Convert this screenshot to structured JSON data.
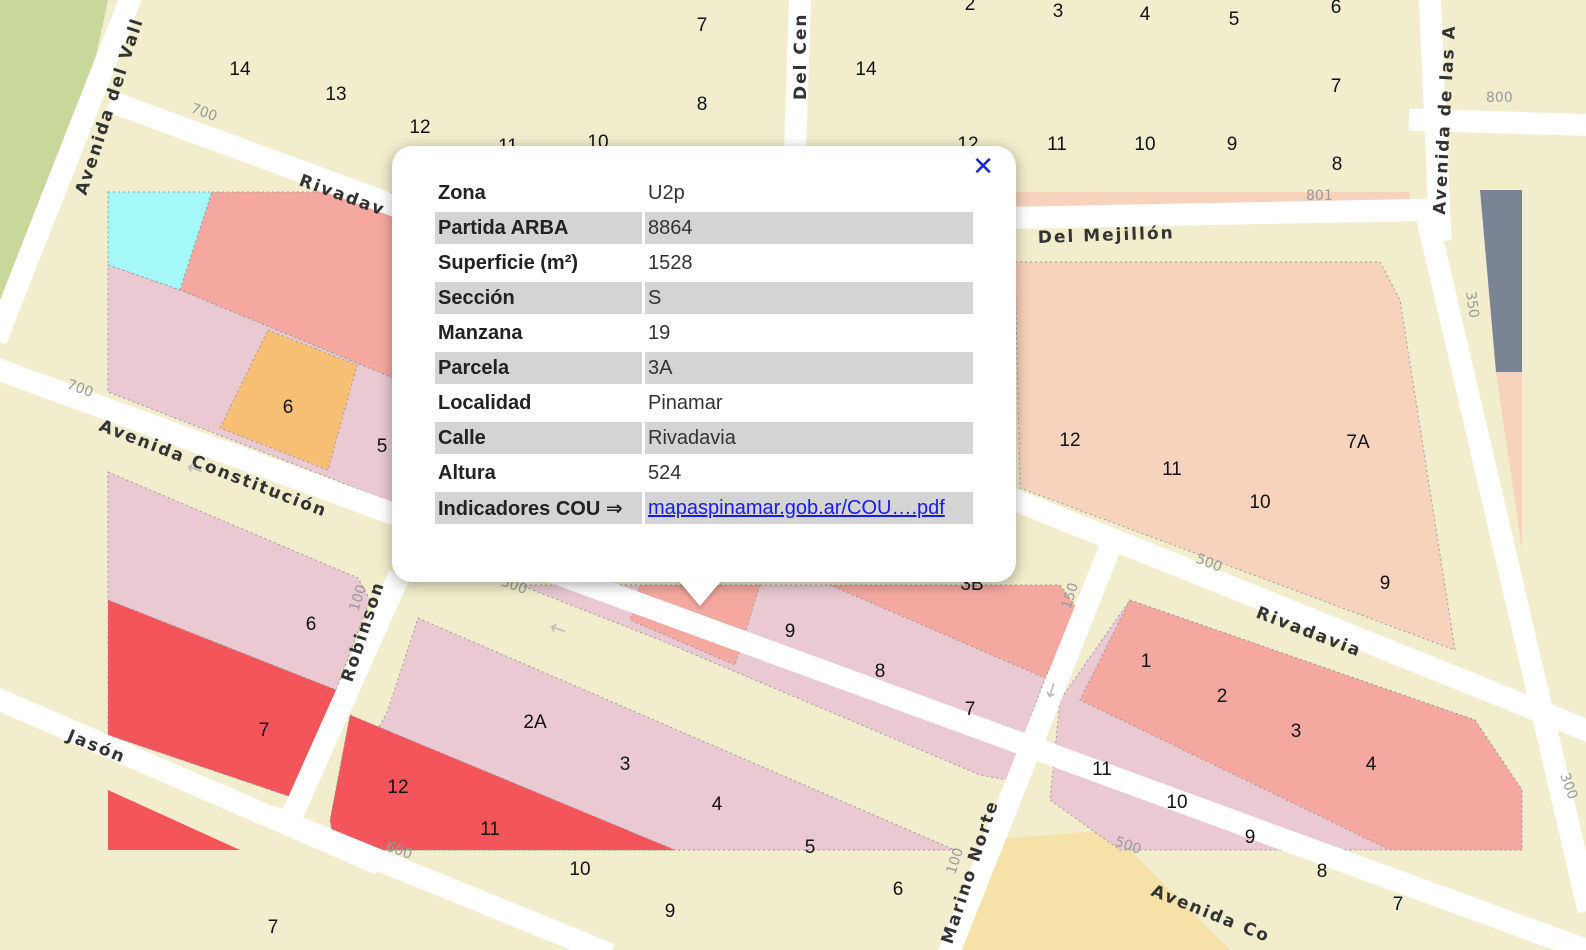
{
  "popup": {
    "close_label": "✕",
    "rows": [
      {
        "key": "Zona",
        "value": "U2p"
      },
      {
        "key": "Partida ARBA",
        "value": "8864"
      },
      {
        "key": "Superficie (m²)",
        "value": "1528"
      },
      {
        "key": "Sección",
        "value": "S"
      },
      {
        "key": "Manzana",
        "value": "19"
      },
      {
        "key": "Parcela",
        "value": "3A"
      },
      {
        "key": "Localidad",
        "value": "Pinamar"
      },
      {
        "key": "Calle",
        "value": "Rivadavia"
      },
      {
        "key": "Altura",
        "value": "524"
      },
      {
        "key": "Indicadores COU ⇒",
        "value": "mapaspinamar.gob.ar/COU….pdf"
      }
    ]
  },
  "streets": {
    "rivadavia_nw": "Rivadav",
    "rivadavia_se": "Rivadavia",
    "constitucion": "Avenida Constitución",
    "del_mejillon": "Del Mejillón",
    "robinson": "Robinson",
    "jason": "Jasón",
    "marino_norte": "Marino Norte",
    "avenida_del_valle": "Avenida del Vall",
    "del_centro": "Del Cen",
    "avenida_de_las": "Avenida de las A",
    "avenida_co": "Avenida Co"
  },
  "address_numbers": [
    "700",
    "700",
    "800",
    "801",
    "350",
    "500",
    "150",
    "100",
    "300",
    "500",
    "600",
    "100",
    "500"
  ],
  "parcel_labels": [
    "14",
    "13",
    "12",
    "11",
    "10",
    "7",
    "8",
    "2",
    "3",
    "4",
    "5",
    "6",
    "14",
    "7",
    "12",
    "11",
    "10",
    "9",
    "8",
    "6",
    "5",
    "12",
    "11",
    "10",
    "7A",
    "9",
    "3B",
    "9",
    "8",
    "7",
    "6",
    "7",
    "2A",
    "3",
    "4",
    "5",
    "12",
    "11",
    "10",
    "9",
    "1",
    "2",
    "3",
    "4",
    "11",
    "10",
    "9",
    "8",
    "7",
    "6",
    "7"
  ],
  "colors": {
    "background": "#f2edcd",
    "road": "#ffffff",
    "parcel_pink": "#eac9d2",
    "parcel_salmon": "#f5a8a0",
    "parcel_peach": "#f7d3bd",
    "parcel_red": "#f4555a",
    "parcel_orange": "#f7bf74",
    "parcel_cyan": "#a4f8f8",
    "parcel_slate": "#7a8494",
    "link": "#1a1aee",
    "close": "#1c23d8"
  }
}
